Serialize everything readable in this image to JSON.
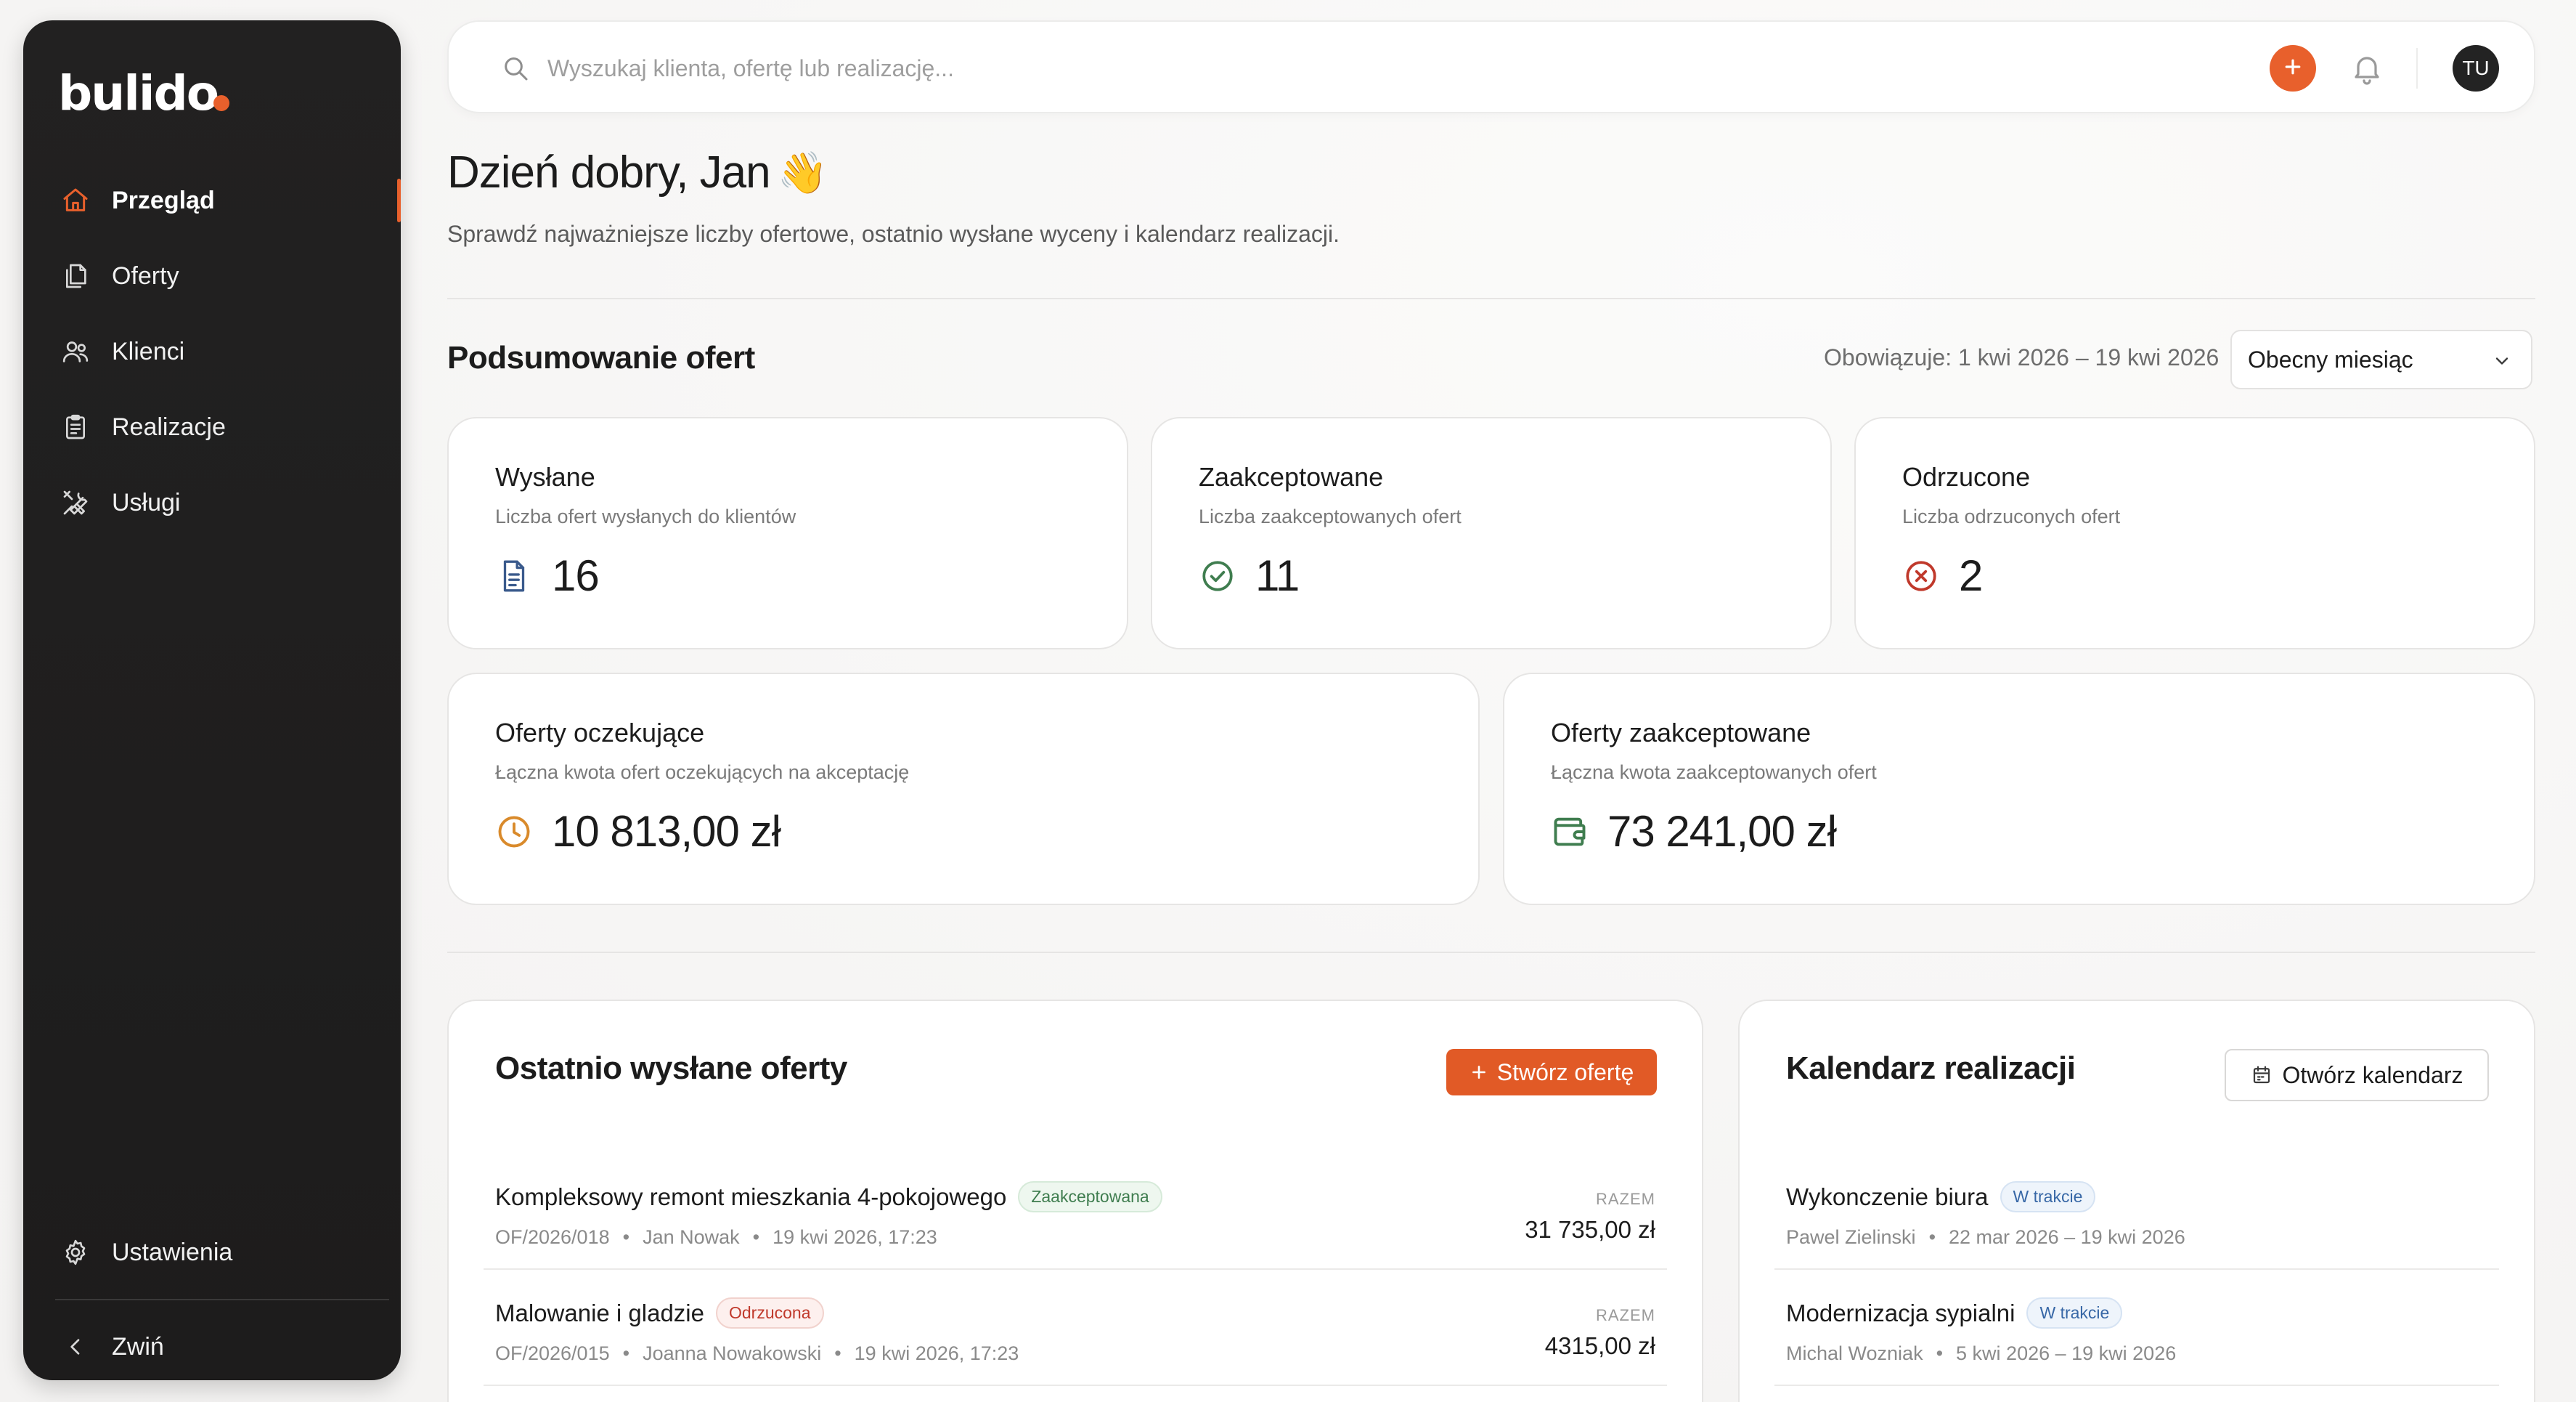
{
  "app": {
    "name": "bulido",
    "brand_color": "#e8602c"
  },
  "sidebar": {
    "items": [
      {
        "label": "Przegląd",
        "icon": "home-icon",
        "active": true
      },
      {
        "label": "Oferty",
        "icon": "documents-icon",
        "active": false
      },
      {
        "label": "Klienci",
        "icon": "users-icon",
        "active": false
      },
      {
        "label": "Realizacje",
        "icon": "clipboard-icon",
        "active": false
      },
      {
        "label": "Usługi",
        "icon": "tools-icon",
        "active": false
      }
    ],
    "settings_label": "Ustawienia",
    "collapse_label": "Zwiń"
  },
  "topbar": {
    "search_placeholder": "Wyszukaj klienta, ofertę lub realizację...",
    "search_value": "",
    "avatar_initials": "TU"
  },
  "header": {
    "greeting": "Dzień dobry, Jan",
    "wave": "👋",
    "subtitle": "Sprawdź najważniejsze liczby ofertowe, ostatnio wysłane wyceny i kalendarz realizacji."
  },
  "summary": {
    "title": "Podsumowanie ofert",
    "period": "Obowiązuje: 1 kwi 2026 – 19 kwi 2026",
    "range_selected": "Obecny miesiąc",
    "cards": [
      {
        "title": "Wysłane",
        "desc": "Liczba ofert wysłanych do klientów",
        "value": "16",
        "icon": "document-icon",
        "color": "#3a5a8c"
      },
      {
        "title": "Zaakceptowane",
        "desc": "Liczba zaakceptowanych ofert",
        "value": "11",
        "icon": "check-circle-icon",
        "color": "#3f7d4f"
      },
      {
        "title": "Odrzucone",
        "desc": "Liczba odrzuconych ofert",
        "value": "2",
        "icon": "x-circle-icon",
        "color": "#c0392b"
      }
    ],
    "amounts": [
      {
        "title": "Oferty oczekujące",
        "desc": "Łączna kwota ofert oczekujących na akceptację",
        "value": "10 813,00 zł",
        "icon": "clock-icon",
        "color": "#d98a2b"
      },
      {
        "title": "Oferty zaakceptowane",
        "desc": "Łączna kwota zaakceptowanych ofert",
        "value": "73 241,00 zł",
        "icon": "wallet-icon",
        "color": "#3f7d4f"
      }
    ]
  },
  "recent_offers": {
    "title": "Ostatnio wysłane oferty",
    "create_label": "Stwórz ofertę",
    "total_label": "RAZEM",
    "items": [
      {
        "title": "Kompleksowy remont mieszkania 4-pokojowego",
        "status": "Zaakceptowana",
        "status_color": "green",
        "number": "OF/2026/018",
        "client": "Jan Nowak",
        "date": "19 kwi 2026, 17:23",
        "total": "31 735,00 zł"
      },
      {
        "title": "Malowanie i gladzie",
        "status": "Odrzucona",
        "status_color": "red",
        "number": "OF/2026/015",
        "client": "Joanna Nowakowski",
        "date": "19 kwi 2026, 17:23",
        "total": "4315,00 zł"
      }
    ]
  },
  "calendar": {
    "title": "Kalendarz realizacji",
    "open_label": "Otwórz kalendarz",
    "items": [
      {
        "title": "Wykonczenie biura",
        "status": "W trakcie",
        "person": "Pawel Zielinski",
        "range": "22 mar 2026 – 19 kwi 2026"
      },
      {
        "title": "Modernizacja sypialni",
        "status": "W trakcie",
        "person": "Michal Wozniak",
        "range": "5 kwi 2026 – 19 kwi 2026"
      }
    ]
  }
}
